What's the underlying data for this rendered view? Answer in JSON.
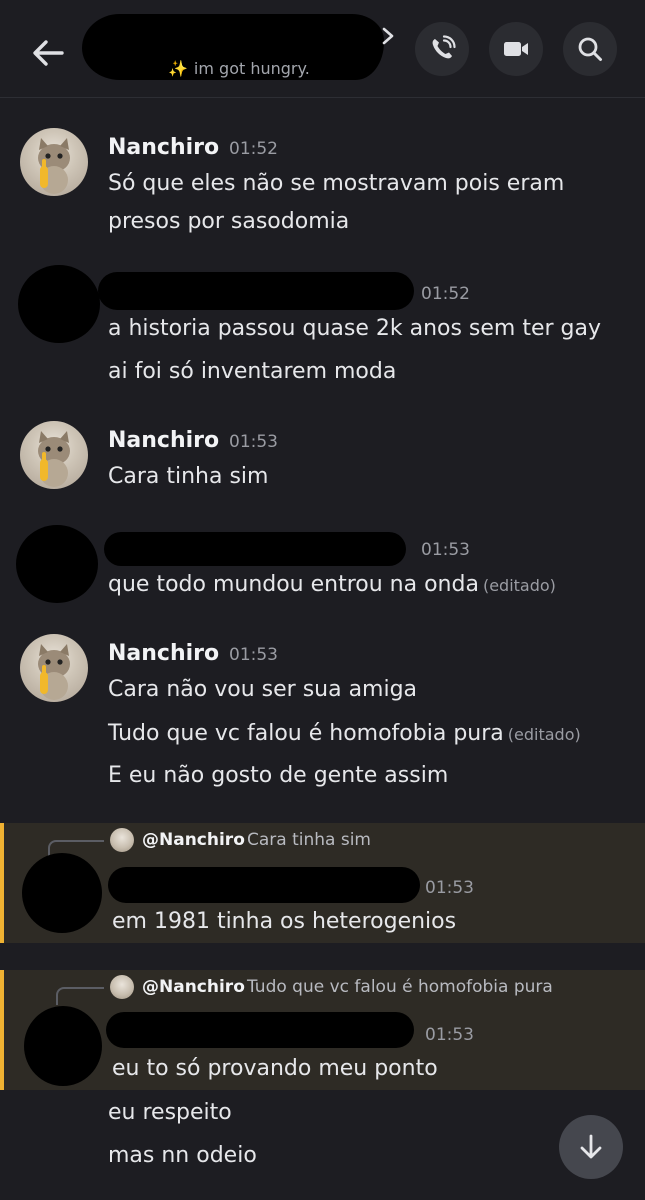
{
  "header": {
    "status_emoji": "✨",
    "status_text": "im got hungry.",
    "icons": [
      "back-arrow-icon",
      "chevron-right-icon",
      "phone-call-icon",
      "video-camera-icon",
      "search-icon"
    ]
  },
  "messages": [
    {
      "author": "Nanchiro",
      "time": "01:52",
      "lines": [
        "Só que eles não se mostravam pois eram",
        "presos por sasodomia"
      ]
    },
    {
      "author": "",
      "time": "01:52",
      "lines": [
        "a historia passou quase 2k anos sem ter gay",
        "ai foi só inventarem moda"
      ]
    },
    {
      "author": "Nanchiro",
      "time": "01:53",
      "lines": [
        "Cara tinha sim"
      ]
    },
    {
      "author": "",
      "time": "01:53",
      "lines": [
        "que todo mundou entrou na onda"
      ],
      "edited": "(editado)"
    },
    {
      "author": "Nanchiro",
      "time": "01:53",
      "lines": [
        "Cara não vou ser sua amiga",
        "Tudo que vc falou é homofobia pura",
        "E eu não gosto de gente assim"
      ],
      "edited": "(editado)"
    }
  ],
  "replies": [
    {
      "reply_to": "@Nanchiro",
      "reply_text": "Cara tinha sim",
      "time": "01:53",
      "lines": [
        "em 1981 tinha os heterogenios"
      ]
    },
    {
      "reply_to": "@Nanchiro",
      "reply_text": "Tudo que vc falou é homofobia pura",
      "time": "01:53",
      "lines": [
        "eu to só provando meu ponto",
        "eu respeito",
        "mas nn odeio"
      ]
    }
  ],
  "colors": {
    "background": "#1d1d22",
    "mention_bar": "#f0b232",
    "mention_bg": "#2e2b25"
  }
}
